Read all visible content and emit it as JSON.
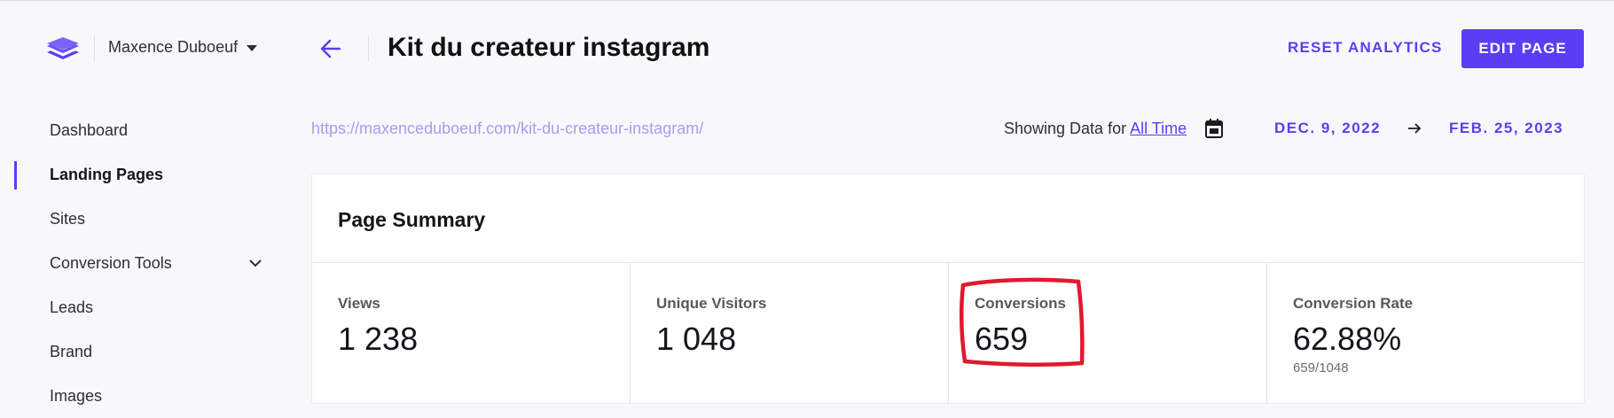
{
  "account": {
    "name": "Maxence Duboeuf"
  },
  "sidebar": {
    "items": [
      {
        "label": "Dashboard"
      },
      {
        "label": "Landing Pages"
      },
      {
        "label": "Sites"
      },
      {
        "label": "Conversion Tools"
      },
      {
        "label": "Leads"
      },
      {
        "label": "Brand"
      },
      {
        "label": "Images"
      }
    ],
    "active": "Landing Pages"
  },
  "header": {
    "title": "Kit du createur instagram",
    "reset_label": "RESET ANALYTICS",
    "edit_label": "EDIT PAGE"
  },
  "subheader": {
    "url": "https://maxenceduboeuf.com/kit-du-createur-instagram/",
    "showing_prefix": "Showing Data for",
    "range_label": "All Time",
    "start_date": "DEC. 9, 2022",
    "end_date": "FEB. 25, 2023"
  },
  "summary": {
    "title": "Page Summary",
    "stats": [
      {
        "label": "Views",
        "value": "1 238",
        "sub": ""
      },
      {
        "label": "Unique Visitors",
        "value": "1 048",
        "sub": ""
      },
      {
        "label": "Conversions",
        "value": "659",
        "sub": ""
      },
      {
        "label": "Conversion Rate",
        "value": "62.88%",
        "sub": "659/1048"
      }
    ]
  },
  "colors": {
    "accent": "#5b3df5",
    "annotation": "#e0192e",
    "url": "#a79cf0",
    "background": "#f8f8fc"
  },
  "icons": {
    "logo": "stacked-layers-icon",
    "account_caret": "caret-down-icon",
    "back": "arrow-left-icon",
    "calendar": "calendar-icon",
    "date_separator": "arrow-right-icon",
    "submenu": "chevron-down-icon"
  }
}
